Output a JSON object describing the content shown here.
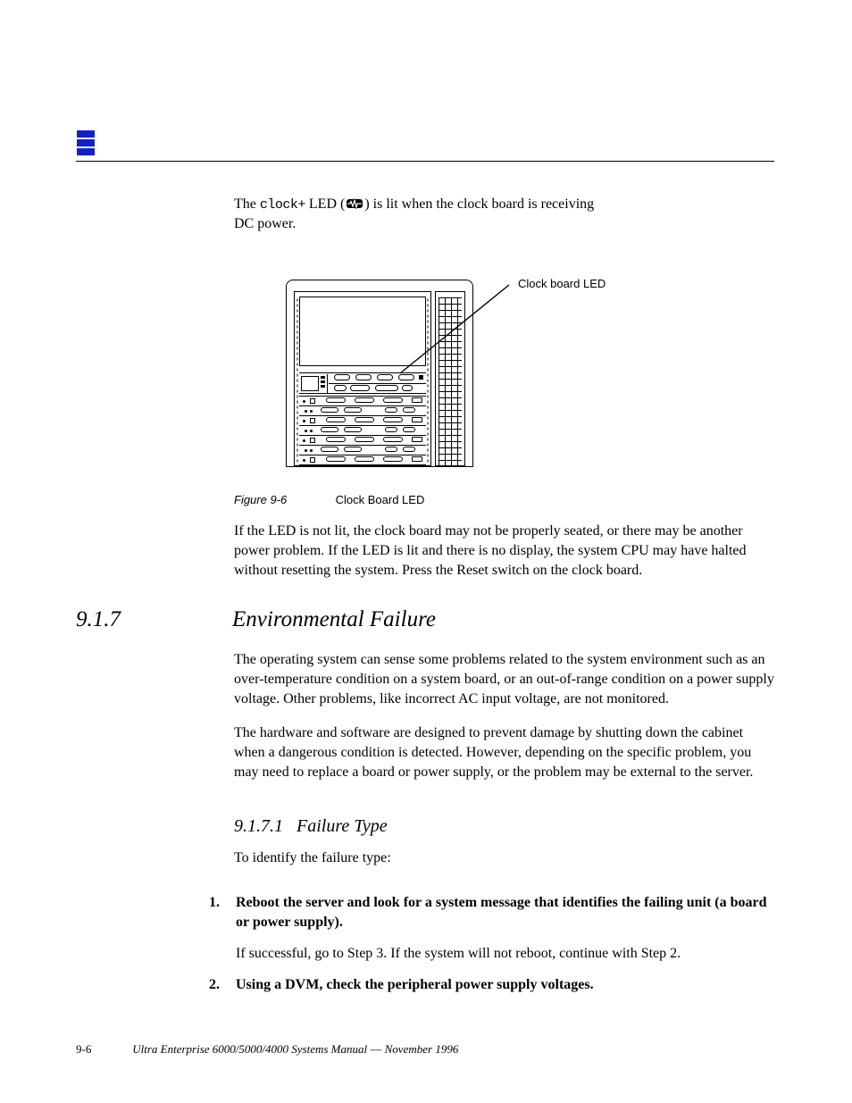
{
  "topline": {
    "prefix": "The ",
    "clock_label": "clock+",
    "mid": " LED (",
    "tail": ") is lit when the clock board is receiving"
  },
  "topline2": "DC power.",
  "callout": "Clock board LED",
  "figure": {
    "label": "Figure 9-6",
    "title": "Clock Board LED"
  },
  "para1": "If the LED is not lit, the clock board may not be properly seated, or there may be another power problem. If the LED is lit and there is no display, the system CPU may have halted without resetting the system. Press the Reset switch on the clock board.",
  "h2": {
    "num": "9.1.7",
    "title": "Environmental Failure"
  },
  "h2body": [
    "The operating system can sense some problems related to the system environment such as an over-temperature condition on a system board, or an out-of-range condition on a power supply voltage. Other problems, like incorrect AC input voltage, are not monitored.",
    "The hardware and software are designed to prevent damage by shutting down the cabinet when a dangerous condition is detected. However, depending on the specific problem, you may need to replace a board or power supply, or the problem may be external to the server."
  ],
  "h3": "9.1.7.1 Failure Type",
  "h3body": "To identify the failure type:",
  "steps": [
    {
      "n": "1.",
      "bold": "Reboot the server and look for a system message that identifies the failing unit (a board or power supply).",
      "plain": "If successful, go to Step 3. If the system will not reboot, continue with Step 2."
    },
    {
      "n": "2.",
      "bold": "Using a DVM, check the peripheral power supply voltages.",
      "plain": ""
    }
  ],
  "footer": {
    "page": "9-6",
    "doc": "Ultra Enterprise 6000/5000/4000 Systems Manual",
    "date": "November 1996"
  }
}
